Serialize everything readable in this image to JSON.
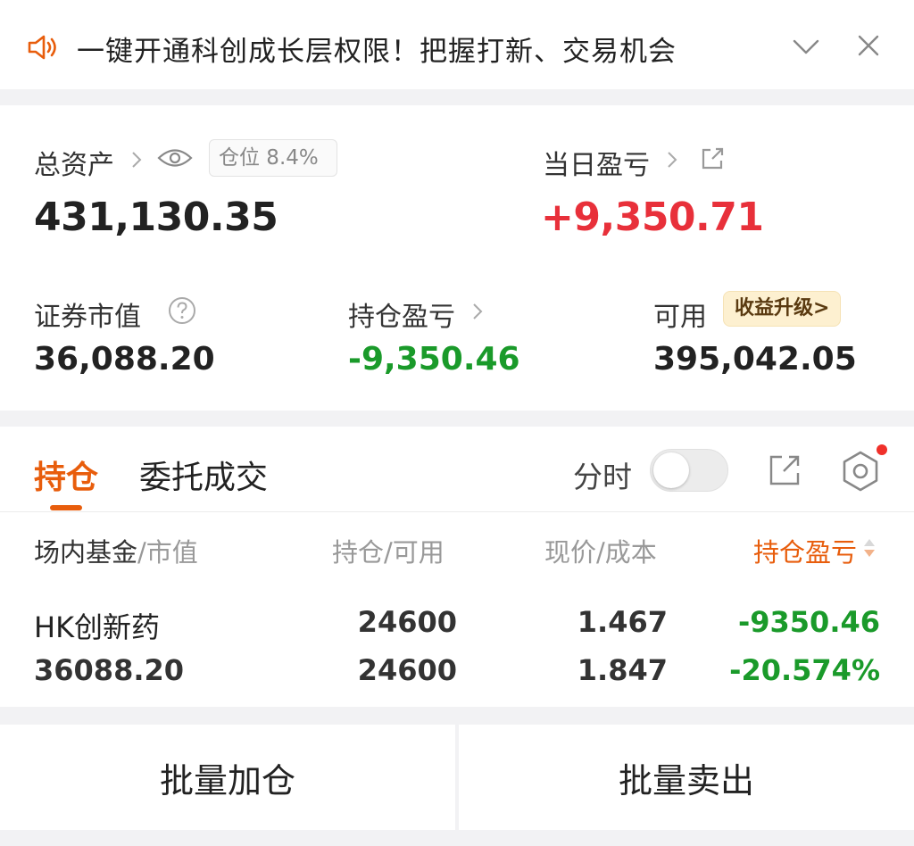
{
  "notice": {
    "text": "一键开通科创成长层权限！把握打新、交易机会"
  },
  "assets": {
    "total_label": "总资产",
    "position_ratio": "仓位 8.4%",
    "total_value": "431,130.35",
    "daily_pl_label": "当日盈亏",
    "daily_pl_value": "+9,350.71",
    "securities_label": "证券市值",
    "securities_value": "36,088.20",
    "holding_pl_label": "持仓盈亏",
    "holding_pl_value": "-9,350.46",
    "available_label": "可用",
    "upgrade_badge": "收益升级>",
    "available_value": "395,042.05"
  },
  "tabs": {
    "holdings": "持仓",
    "orders": "委托成交",
    "fenshi": "分时"
  },
  "table": {
    "headers": {
      "col1_main": "场内基金",
      "col1_sub": "/市值",
      "col2": "持仓/可用",
      "col3": "现价/成本",
      "col4": "持仓盈亏"
    },
    "rows": [
      {
        "name": "HK创新药",
        "market_value": "36088.20",
        "holding": "24600",
        "available": "24600",
        "price": "1.467",
        "cost": "1.847",
        "pl": "-9350.46",
        "pl_pct": "-20.574%"
      }
    ]
  },
  "actions": {
    "batch_buy": "批量加仓",
    "batch_sell": "批量卖出"
  },
  "colors": {
    "accent": "#e85d0c",
    "gain": "#e8303a",
    "loss": "#1a9a2a"
  },
  "toggle_fenshi_on": false
}
